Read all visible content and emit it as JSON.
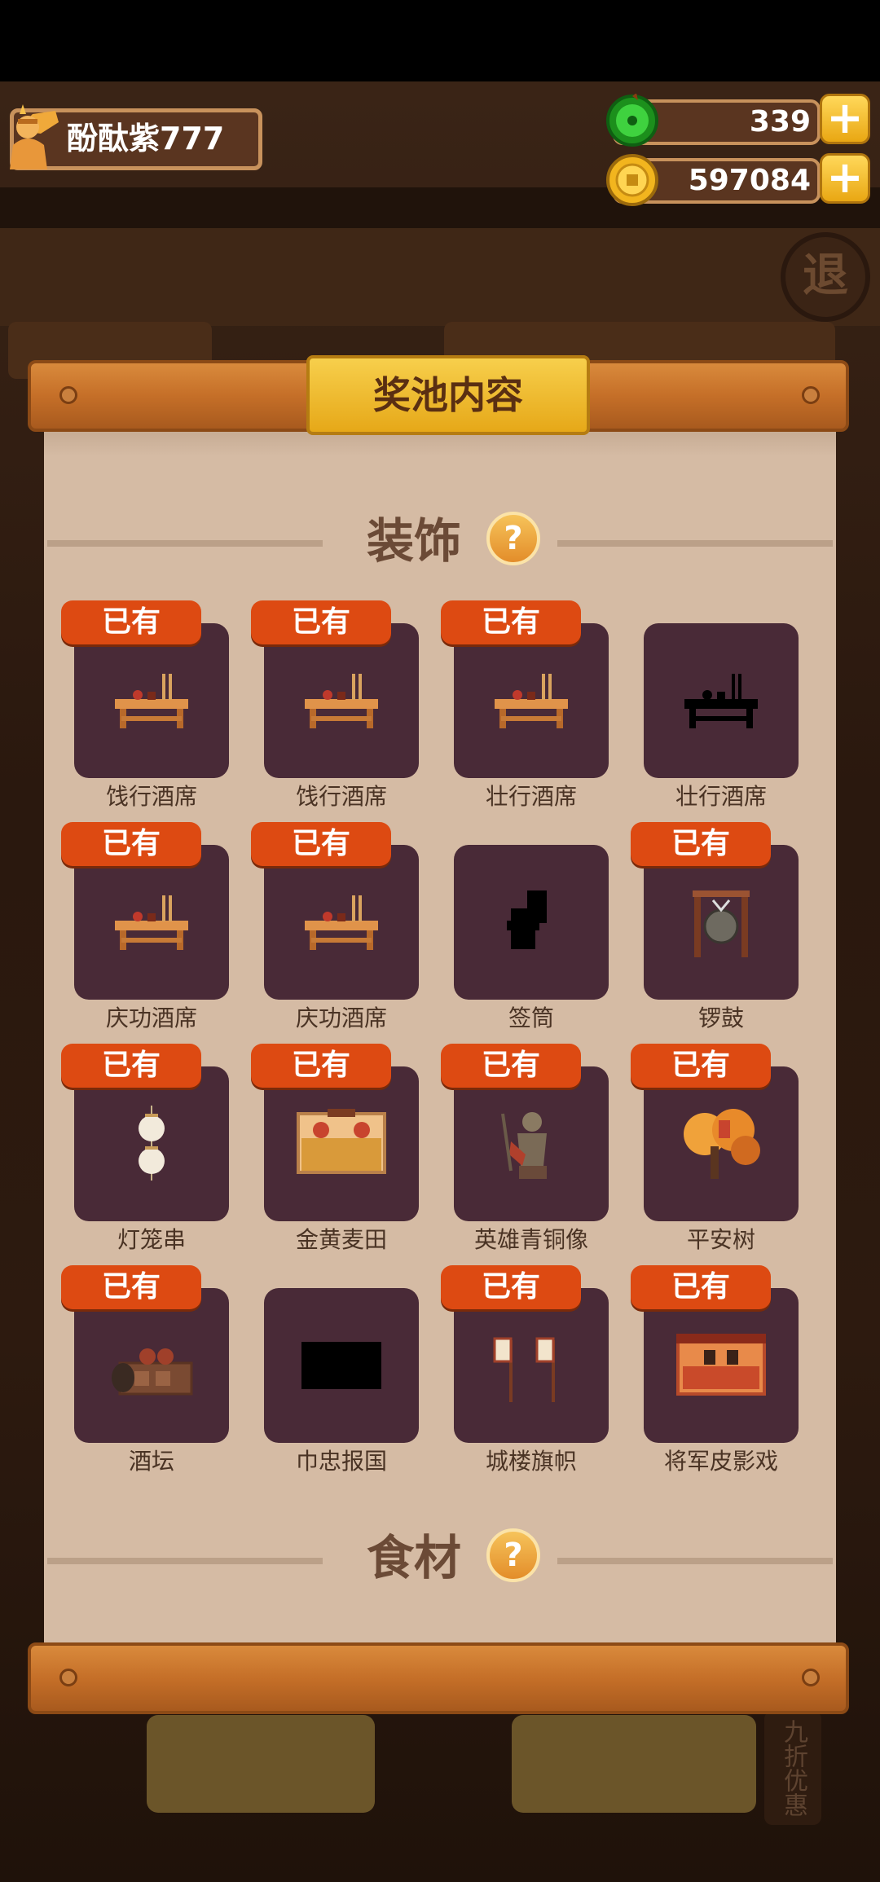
{
  "player": {
    "name": "酚酞紫777"
  },
  "resources": [
    {
      "icon": "jade-icon",
      "value": "339"
    },
    {
      "icon": "gold-coin-icon",
      "value": "597084"
    }
  ],
  "background": {
    "exit_char": "退",
    "side_label": "九折优惠"
  },
  "modal": {
    "title": "奖池内容",
    "sections": [
      {
        "title": "装饰",
        "items": [
          {
            "name": "饯行酒席",
            "owned": true
          },
          {
            "name": "饯行酒席",
            "owned": true
          },
          {
            "name": "壮行酒席",
            "owned": true
          },
          {
            "name": "壮行酒席",
            "owned": false
          },
          {
            "name": "庆功酒席",
            "owned": true
          },
          {
            "name": "庆功酒席",
            "owned": true
          },
          {
            "name": "签筒",
            "owned": false
          },
          {
            "name": "锣鼓",
            "owned": true
          },
          {
            "name": "灯笼串",
            "owned": true
          },
          {
            "name": "金黄麦田",
            "owned": true
          },
          {
            "name": "英雄青铜像",
            "owned": true
          },
          {
            "name": "平安树",
            "owned": true
          },
          {
            "name": "酒坛",
            "owned": true
          },
          {
            "name": "巾忠报国",
            "owned": false
          },
          {
            "name": "城楼旗帜",
            "owned": true
          },
          {
            "name": "将军皮影戏",
            "owned": true
          }
        ]
      },
      {
        "title": "食材",
        "items": []
      }
    ],
    "owned_badge": "已有",
    "help_symbol": "?"
  },
  "colors": {
    "accent": "#dd4a12",
    "panel": "#d5bba4",
    "card": "#492a37",
    "title_plate": "#f0bd2e"
  }
}
